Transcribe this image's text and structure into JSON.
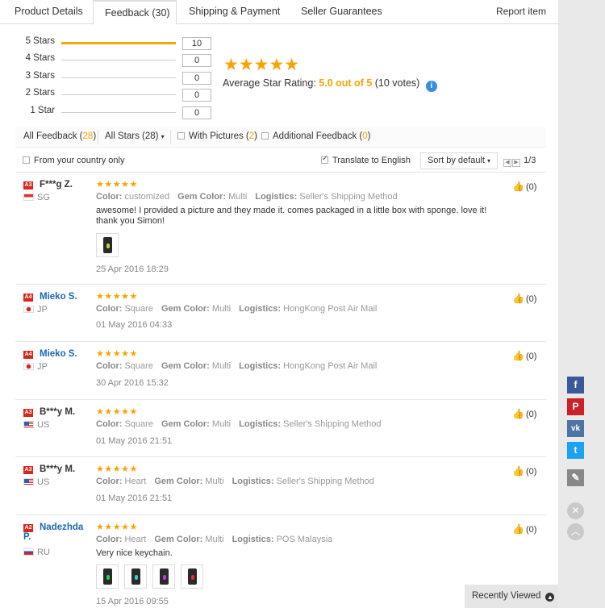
{
  "tabs": [
    {
      "label": "Product Details"
    },
    {
      "label": "Feedback (30)"
    },
    {
      "label": "Shipping & Payment"
    },
    {
      "label": "Seller Guarantees"
    }
  ],
  "report_label": "Report item",
  "rating_breakdown": [
    {
      "label": "5 Stars",
      "count": "10",
      "fraction": 1.0
    },
    {
      "label": "4 Stars",
      "count": "0",
      "fraction": 0
    },
    {
      "label": "3 Stars",
      "count": "0",
      "fraction": 0
    },
    {
      "label": "2 Stars",
      "count": "0",
      "fraction": 0
    },
    {
      "label": "1 Star",
      "count": "0",
      "fraction": 0
    }
  ],
  "average": {
    "stars": "★★★★★",
    "label": "Average Star Rating:",
    "value": "5.0 out of 5",
    "votes": "(10 votes)",
    "info_icon": "i"
  },
  "filters": {
    "all_feedback": "All Feedback (",
    "all_feedback_count": "28",
    "all_feedback_close": ")",
    "all_stars": "All Stars (28)",
    "with_pictures": "With Pictures (",
    "with_pictures_count": "2",
    "with_pictures_close": ")",
    "additional": "Additional Feedback (",
    "additional_count": "0",
    "additional_close": ")",
    "from_country": "From your country only",
    "translate": "Translate to English",
    "sort": "Sort by default",
    "page": "1/3"
  },
  "reviews": [
    {
      "badge": "A3",
      "name": "F***g Z.",
      "country": "SG",
      "stars": "★★★★★",
      "color_label": "Color:",
      "color": "customized",
      "gem_label": "Gem Color:",
      "gem": "Multi",
      "logistics_label": "Logistics:",
      "logistics": "Seller's Shipping Method",
      "text": "awesome! I provided a picture and they made it. comes packaged in a little box with sponge. love it! thank you Simon!",
      "date": "25 Apr 2016 18:29",
      "useful": "(0)"
    },
    {
      "badge": "A4",
      "name": "Mieko S.",
      "country": "JP",
      "stars": "★★★★★",
      "color_label": "Color:",
      "color": "Square",
      "gem_label": "Gem Color:",
      "gem": "Multi",
      "logistics_label": "Logistics:",
      "logistics": "HongKong Post Air Mail",
      "text": "",
      "date": "01 May 2016 04:33",
      "useful": "(0)"
    },
    {
      "badge": "A4",
      "name": "Mieko S.",
      "country": "JP",
      "stars": "★★★★★",
      "color_label": "Color:",
      "color": "Square",
      "gem_label": "Gem Color:",
      "gem": "Multi",
      "logistics_label": "Logistics:",
      "logistics": "HongKong Post Air Mail",
      "text": "",
      "date": "30 Apr 2016 15:32",
      "useful": "(0)"
    },
    {
      "badge": "A3",
      "name": "B***y M.",
      "country": "US",
      "stars": "★★★★★",
      "color_label": "Color:",
      "color": "Square",
      "gem_label": "Gem Color:",
      "gem": "Multi",
      "logistics_label": "Logistics:",
      "logistics": "Seller's Shipping Method",
      "text": "",
      "date": "01 May 2016 21:51",
      "useful": "(0)"
    },
    {
      "badge": "A3",
      "name": "B***y M.",
      "country": "US",
      "stars": "★★★★★",
      "color_label": "Color:",
      "color": "Heart",
      "gem_label": "Gem Color:",
      "gem": "Multi",
      "logistics_label": "Logistics:",
      "logistics": "Seller's Shipping Method",
      "text": "",
      "date": "01 May 2016 21:51",
      "useful": "(0)"
    },
    {
      "badge": "A2",
      "name": "Nadezhda",
      "name2": "P.",
      "country": "RU",
      "stars": "★★★★★",
      "color_label": "Color:",
      "color": "Heart",
      "gem_label": "Gem Color:",
      "gem": "Multi",
      "logistics_label": "Logistics:",
      "logistics": "POS Malaysia",
      "text": "Very nice keychain.",
      "date": "15 Apr 2016 09:55",
      "useful": "(0)"
    }
  ],
  "social": [
    {
      "glyph": "f",
      "color": "#3b5998"
    },
    {
      "glyph": "P",
      "color": "#cb2027"
    },
    {
      "glyph": "vk",
      "color": "#4c75a3"
    },
    {
      "glyph": "t",
      "color": "#1da1f2"
    },
    {
      "glyph": "✎",
      "color": "#888888"
    }
  ],
  "close_glyph": "✕",
  "top_glyph": "︿",
  "recently_viewed": "Recently Viewed",
  "colors": {
    "accent": "#f8a300",
    "link": "#1b66b3",
    "badge": "#d9261c"
  }
}
